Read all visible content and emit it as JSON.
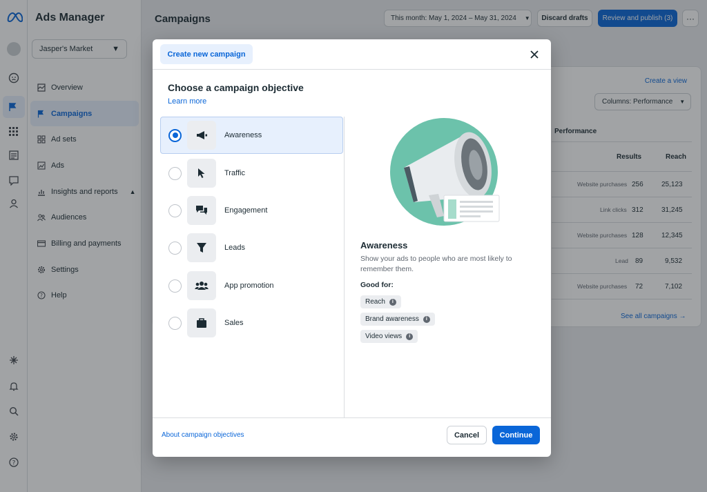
{
  "app": {
    "title": "Ads Manager"
  },
  "account": {
    "name": "Jasper's Market"
  },
  "nav": {
    "items": [
      {
        "label": "Overview",
        "icon": "overview-icon"
      },
      {
        "label": "Campaigns",
        "icon": "flag-icon",
        "active": true
      },
      {
        "label": "Ad sets",
        "icon": "grid-icon"
      },
      {
        "label": "Ads",
        "icon": "image-icon"
      },
      {
        "label": "Insights and reports",
        "icon": "chart-icon",
        "expandable": true
      },
      {
        "label": "Audiences",
        "icon": "people-icon"
      },
      {
        "label": "Billing and payments",
        "icon": "card-icon"
      },
      {
        "label": "Settings",
        "icon": "gear-icon"
      },
      {
        "label": "Help",
        "icon": "help-icon"
      }
    ]
  },
  "header": {
    "title": "Campaigns",
    "date_range": "This month: May 1, 2024 – May 31, 2024",
    "discard_label": "Discard drafts",
    "review_label": "Review and publish (3)",
    "more_label": "···"
  },
  "background_panel": {
    "create_view": "Create a view",
    "columns": "Columns: Performance",
    "section": "Performance",
    "headers": [
      "Results",
      "Reach"
    ],
    "rows": [
      {
        "type": "Website purchases",
        "results": "256",
        "reach": "25,123"
      },
      {
        "type": "Link clicks",
        "results": "312",
        "reach": "31,245"
      },
      {
        "type": "Website purchases",
        "results": "128",
        "reach": "12,345"
      },
      {
        "type": "Lead",
        "results": "89",
        "reach": "9,532"
      },
      {
        "type": "Website purchases",
        "results": "72",
        "reach": "7,102"
      }
    ],
    "see_all": "See all campaigns"
  },
  "modal": {
    "tab": "Create new campaign",
    "heading": "Choose a campaign objective",
    "learn_more": "Learn more",
    "objectives": [
      {
        "label": "Awareness",
        "icon": "megaphone-icon",
        "selected": true
      },
      {
        "label": "Traffic",
        "icon": "cursor-icon"
      },
      {
        "label": "Engagement",
        "icon": "chat-icon"
      },
      {
        "label": "Leads",
        "icon": "filter-icon"
      },
      {
        "label": "App promotion",
        "icon": "people-icon"
      },
      {
        "label": "Sales",
        "icon": "bag-icon"
      }
    ],
    "detail": {
      "title": "Awareness",
      "description": "Show your ads to people who are most likely to remember them.",
      "good_for_label": "Good for:",
      "good_for": [
        "Reach",
        "Brand awareness",
        "Video views"
      ]
    },
    "about_link": "About campaign objectives",
    "cancel_label": "Cancel",
    "continue_label": "Continue"
  },
  "colors": {
    "accent": "#0a66d8",
    "selected_bg": "#e7f0fd",
    "illustration_teal": "#6cc2ab"
  }
}
